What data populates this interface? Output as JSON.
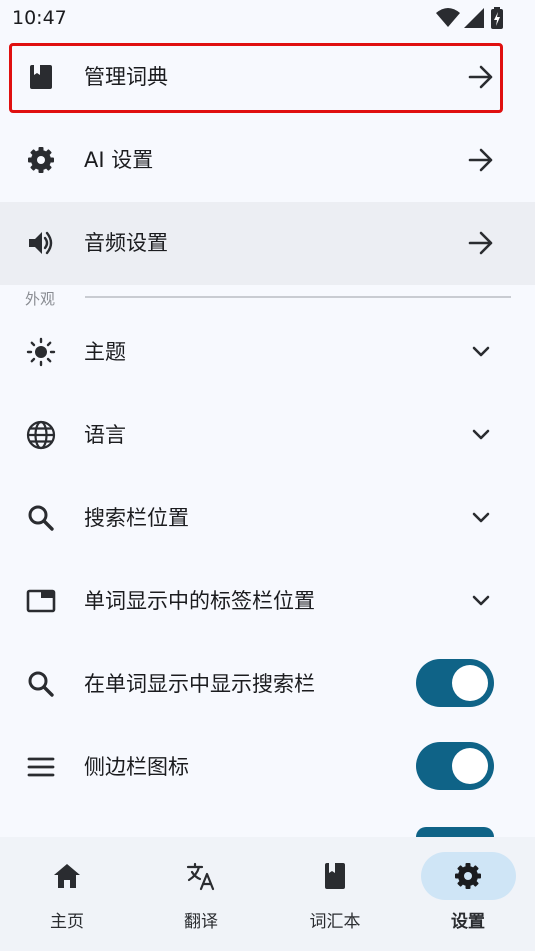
{
  "status_bar": {
    "time": "10:47",
    "icons": [
      "wifi-icon",
      "signal-icon",
      "battery-charging-icon"
    ]
  },
  "settings": {
    "manage_dict": {
      "label": "管理词典",
      "icon": "book-icon"
    },
    "ai_settings": {
      "label": "AI 设置",
      "icon": "gear-icon"
    },
    "audio_settings": {
      "label": "音频设置",
      "icon": "speaker-icon"
    },
    "appearance_header": "外观",
    "theme": {
      "label": "主题",
      "icon": "sun-icon"
    },
    "language": {
      "label": "语言",
      "icon": "globe-icon"
    },
    "search_bar_position": {
      "label": "搜索栏位置",
      "icon": "search-icon"
    },
    "tab_bar_position": {
      "label": "单词显示中的标签栏位置",
      "icon": "window-tab-icon"
    },
    "show_search_bar": {
      "label": "在单词显示中显示搜索栏",
      "icon": "search-icon",
      "enabled": true
    },
    "sidebar_icons": {
      "label": "侧边栏图标",
      "icon": "menu-icon",
      "enabled": true
    }
  },
  "nav": {
    "items": [
      {
        "label": "主页",
        "icon": "home-icon"
      },
      {
        "label": "翻译",
        "icon": "translate-icon"
      },
      {
        "label": "词汇本",
        "icon": "book-icon"
      },
      {
        "label": "设置",
        "icon": "gear-icon",
        "active": true
      }
    ]
  },
  "colors": {
    "accent": "#0f6387",
    "highlight_border": "#e01010",
    "nav_active_pill": "#cfe5f6",
    "background": "#f7f9fe"
  }
}
